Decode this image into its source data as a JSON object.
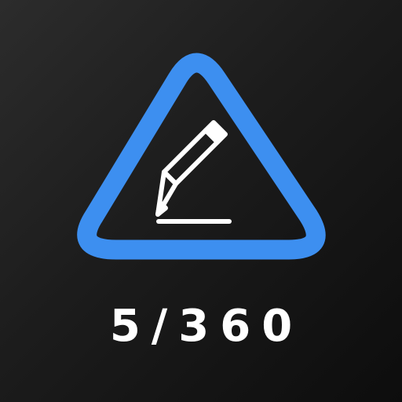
{
  "app_icon": {
    "label": "5/360",
    "colors": {
      "background_light": "#2c2c2c",
      "background_dark": "#0d0d0d",
      "triangle_stroke": "#3d8ff0",
      "pencil": "#ffffff",
      "label_text": "#ffffff"
    },
    "icons": [
      "triangle-frame-icon",
      "pencil-icon"
    ]
  }
}
